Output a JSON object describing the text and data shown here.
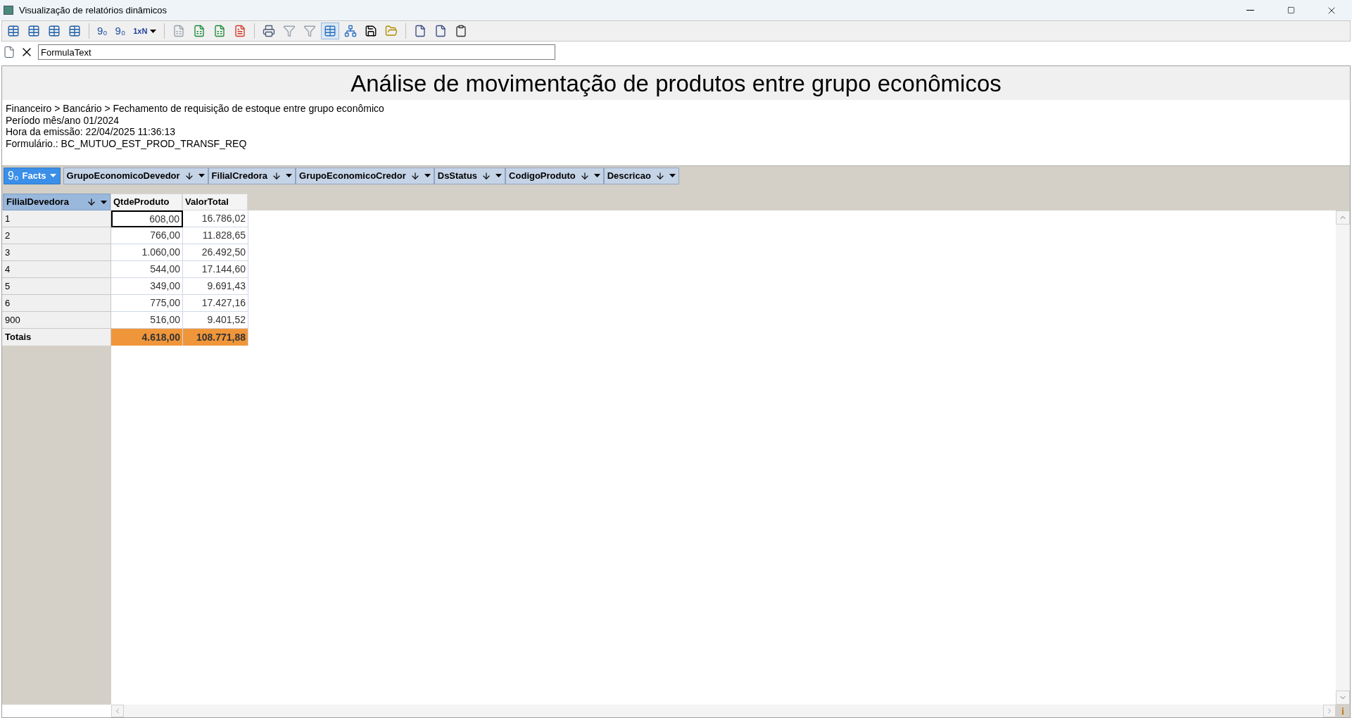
{
  "window": {
    "title": "Visualização de relatórios dinâmicos"
  },
  "toolbar": [
    {
      "kind": "icon",
      "disabled": false,
      "selected": false
    },
    {
      "kind": "icon",
      "disabled": false,
      "selected": false
    },
    {
      "kind": "icon",
      "disabled": false,
      "selected": false
    },
    {
      "kind": "icon",
      "disabled": false,
      "selected": false
    },
    {
      "kind": "separator"
    },
    {
      "kind": "glyph",
      "label": "9₀",
      "disabled": false,
      "selected": false
    },
    {
      "kind": "glyph",
      "label": "9₀",
      "disabled": false,
      "selected": false
    },
    {
      "kind": "dropdown",
      "label": "1xN",
      "disabled": false,
      "selected": false
    },
    {
      "kind": "separator"
    },
    {
      "kind": "icon",
      "disabled": true,
      "selected": false
    },
    {
      "kind": "icon",
      "disabled": false,
      "selected": false
    },
    {
      "kind": "icon",
      "disabled": false,
      "selected": false
    },
    {
      "kind": "icon",
      "disabled": false,
      "selected": false
    },
    {
      "kind": "separator"
    },
    {
      "kind": "icon",
      "disabled": false,
      "selected": false
    },
    {
      "kind": "icon",
      "disabled": true,
      "selected": false
    },
    {
      "kind": "icon",
      "disabled": true,
      "selected": false
    },
    {
      "kind": "icon",
      "disabled": false,
      "selected": true
    },
    {
      "kind": "icon",
      "disabled": false,
      "selected": false
    },
    {
      "kind": "icon",
      "disabled": false,
      "selected": false
    },
    {
      "kind": "icon",
      "disabled": false,
      "selected": false
    },
    {
      "kind": "separator"
    },
    {
      "kind": "icon",
      "disabled": false,
      "selected": false
    },
    {
      "kind": "icon",
      "disabled": false,
      "selected": false
    },
    {
      "kind": "icon",
      "disabled": false,
      "selected": false
    }
  ],
  "formula_bar": {
    "value": "FormulaText"
  },
  "report": {
    "title": "Análise de movimentação de produtos entre grupo econômicos",
    "info_lines": [
      "Financeiro > Bancário > Fechamento de requisição de estoque entre grupo econômico",
      "Período mês/ano 01/2024",
      "Hora da emissão: 22/04/2025 11:36:13",
      "Formulário.: BC_MUTUO_EST_PROD_TRANSF_REQ"
    ]
  },
  "facts_button": {
    "glyph": "9₀",
    "label": "Facts"
  },
  "filter_fields": [
    "GrupoEconomicoDevedor",
    "FilialCredora",
    "GrupoEconomicoCredor",
    "DsStatus",
    "CodigoProduto",
    "Descricao"
  ],
  "pivot": {
    "row_field": "FilialDevedora",
    "columns": [
      "QtdeProduto",
      "ValorTotal"
    ],
    "rows": [
      {
        "label": "1",
        "cells": [
          {
            "text": "608,00",
            "selected": true
          },
          {
            "text": "16.786,02",
            "selected": false
          }
        ]
      },
      {
        "label": "2",
        "cells": [
          {
            "text": "766,00",
            "selected": false
          },
          {
            "text": "11.828,65",
            "selected": false
          }
        ]
      },
      {
        "label": "3",
        "cells": [
          {
            "text": "1.060,00",
            "selected": false
          },
          {
            "text": "26.492,50",
            "selected": false
          }
        ]
      },
      {
        "label": "4",
        "cells": [
          {
            "text": "544,00",
            "selected": false
          },
          {
            "text": "17.144,60",
            "selected": false
          }
        ]
      },
      {
        "label": "5",
        "cells": [
          {
            "text": "349,00",
            "selected": false
          },
          {
            "text": "9.691,43",
            "selected": false
          }
        ]
      },
      {
        "label": "6",
        "cells": [
          {
            "text": "775,00",
            "selected": false
          },
          {
            "text": "17.427,16",
            "selected": false
          }
        ]
      },
      {
        "label": "900",
        "cells": [
          {
            "text": "516,00",
            "selected": false
          },
          {
            "text": "9.401,52",
            "selected": false
          }
        ]
      }
    ],
    "totals": {
      "label": "Totais",
      "cells": [
        "4.618,00",
        "108.771,88"
      ]
    }
  },
  "info_button": {
    "label": "i"
  }
}
